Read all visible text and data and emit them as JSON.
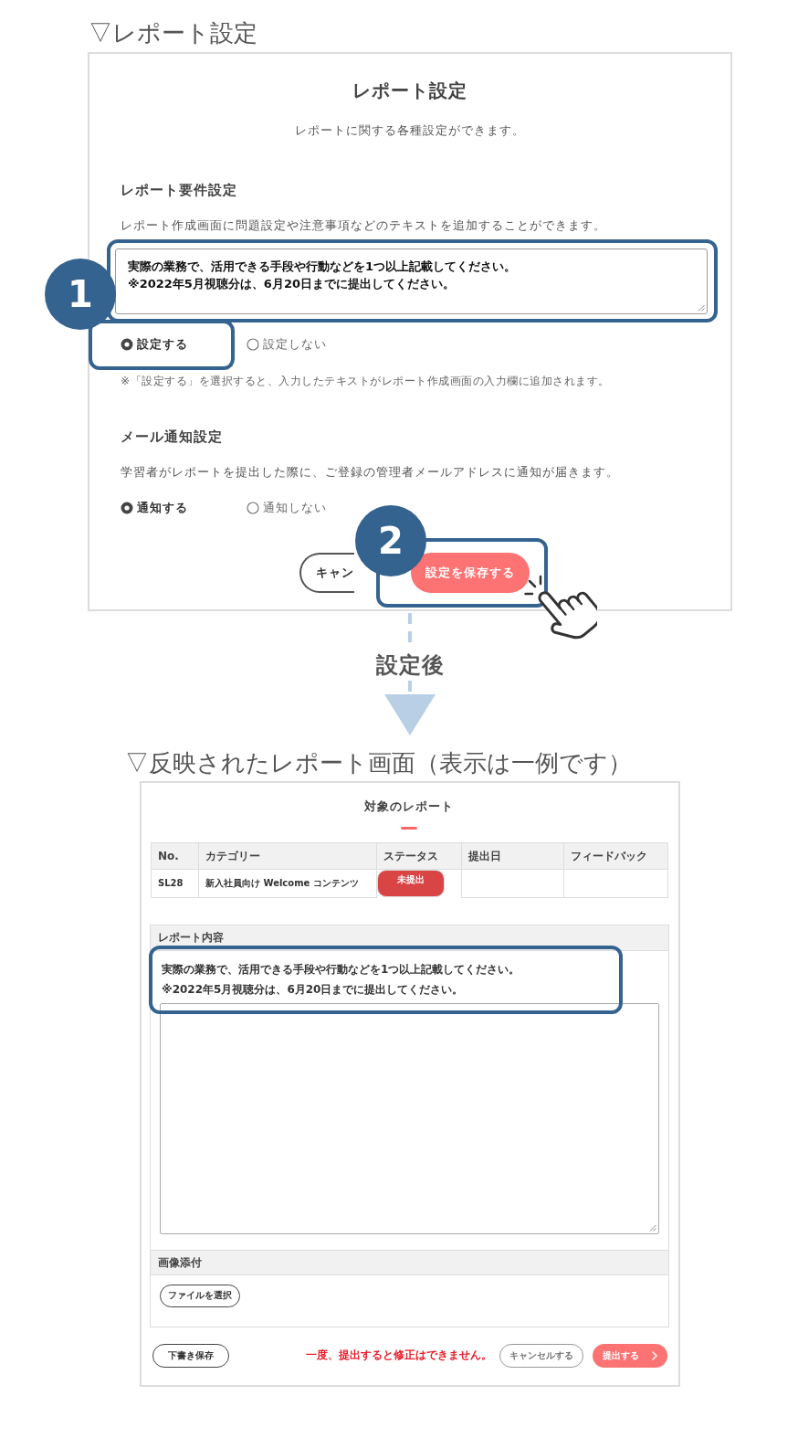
{
  "settings_caption": "▽レポート設定",
  "settings_panel": {
    "title": "レポート設定",
    "subtitle": "レポートに関する各種設定ができます。",
    "sections": [
      {
        "heading": "レポート要件設定",
        "description": "レポート作成画面に問題設定や注意事項などのテキストを追加することができます。",
        "field": {
          "value": "実際の業務で、活用できる手段や行動などを1つ以上記載してください。\n※2022年5月視聴分は、6月20日までに提出してください。",
          "highlighted": true,
          "callout": "1"
        },
        "options": [
          {
            "label": "設定する",
            "selected": true,
            "highlighted": true
          },
          {
            "label": "設定しない",
            "selected": false,
            "highlighted": false
          }
        ],
        "note": "※「設定する」を選択すると、入力したテキストがレポート作成画面の入力欄に追加されます。"
      },
      {
        "heading": "メール通知設定",
        "description": "学習者がレポートを提出した際に、ご登録の管理者メールアドレスに通知が届きます。",
        "options": [
          {
            "label": "通知する",
            "selected": true,
            "highlighted": false
          },
          {
            "label": "通知しない",
            "selected": false,
            "highlighted": false
          }
        ]
      }
    ],
    "buttons": [
      {
        "kind": "secondary",
        "label": "キャン",
        "highlighted": false,
        "tapped": false
      },
      {
        "kind": "primary",
        "label": "設定を保存する",
        "highlighted": true,
        "tapped": true,
        "callout": "2"
      }
    ]
  },
  "transition": {
    "label": "設定後"
  },
  "result_caption": "▽反映されたレポート画面（表示は一例です）",
  "result_panel": {
    "title": "対象のレポート",
    "table": {
      "columns": [
        "No.",
        "カテゴリー",
        "ステータス",
        "提出日",
        "フィードバック"
      ],
      "rows": [
        {
          "cells": [
            {
              "kind": "text",
              "text": "SL28"
            },
            {
              "kind": "text",
              "text": "新入社員向け Welcome コンテンツ"
            },
            {
              "kind": "status",
              "text": "未提出"
            },
            {
              "kind": "empty"
            },
            {
              "kind": "empty"
            }
          ]
        }
      ]
    },
    "content_section": {
      "heading": "レポート内容",
      "instructions": {
        "highlighted": true,
        "lines": [
          "実際の業務で、活用できる手段や行動などを1つ以上記載してください。",
          "※2022年5月視聴分は、6月20日までに提出してください。"
        ]
      }
    },
    "attachment_section": {
      "heading": "画像添付",
      "button": "ファイルを選択"
    },
    "footer": {
      "draft_button": "下書き保存",
      "warning": "一度、提出すると修正はできません。",
      "buttons": [
        {
          "kind": "secondary",
          "label": "キャンセルする"
        },
        {
          "kind": "primary",
          "label": "提出する"
        }
      ]
    }
  }
}
